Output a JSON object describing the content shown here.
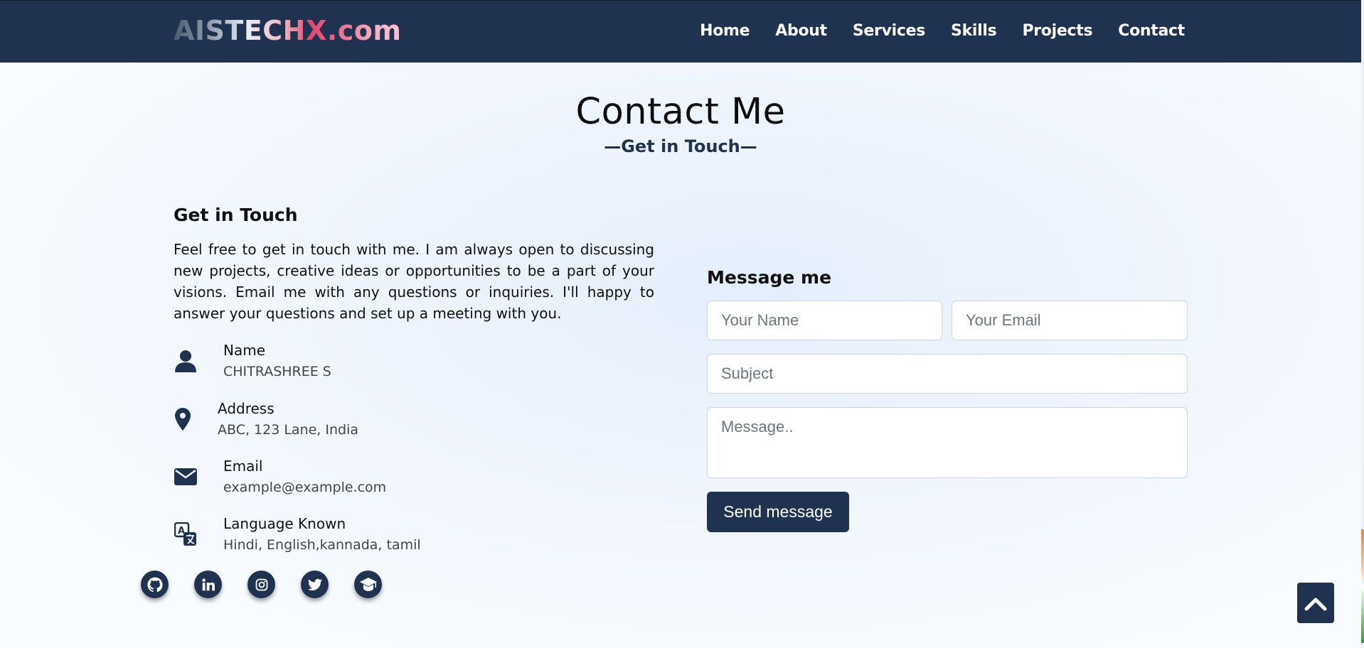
{
  "navbar": {
    "logo": "AISTECHX.com",
    "links": [
      "Home",
      "About",
      "Services",
      "Skills",
      "Projects",
      "Contact"
    ]
  },
  "section": {
    "title": "Contact Me",
    "subtitle": "—Get in Touch—"
  },
  "contact_info": {
    "heading": "Get in Touch",
    "intro": "Feel free to get in touch with me. I am always open to discussing new projects, creative ideas or opportunities to be a part of your visions. Email me with any questions or inquiries. I'll happy to answer your questions and set up a meeting with you.",
    "items": [
      {
        "label": "Name",
        "value": "CHITRASHREE S",
        "icon": "user-icon"
      },
      {
        "label": "Address",
        "value": "ABC, 123 Lane, India",
        "icon": "map-pin-icon"
      },
      {
        "label": "Email",
        "value": "example@example.com",
        "icon": "envelope-icon"
      },
      {
        "label": "Language Known",
        "value": "Hindi, English,kannada, tamil",
        "icon": "language-icon"
      }
    ]
  },
  "social": [
    "github-icon",
    "linkedin-icon",
    "instagram-icon",
    "twitter-icon",
    "graduation-cap-icon"
  ],
  "form": {
    "heading": "Message me",
    "name_placeholder": "Your Name",
    "email_placeholder": "Your Email",
    "subject_placeholder": "Subject",
    "message_placeholder": "Message..",
    "submit_label": "Send message"
  },
  "colors": {
    "primary": "#1f3350",
    "logo_accent": "#e0486c"
  },
  "back_to_top_icon": "chevron-up-icon"
}
